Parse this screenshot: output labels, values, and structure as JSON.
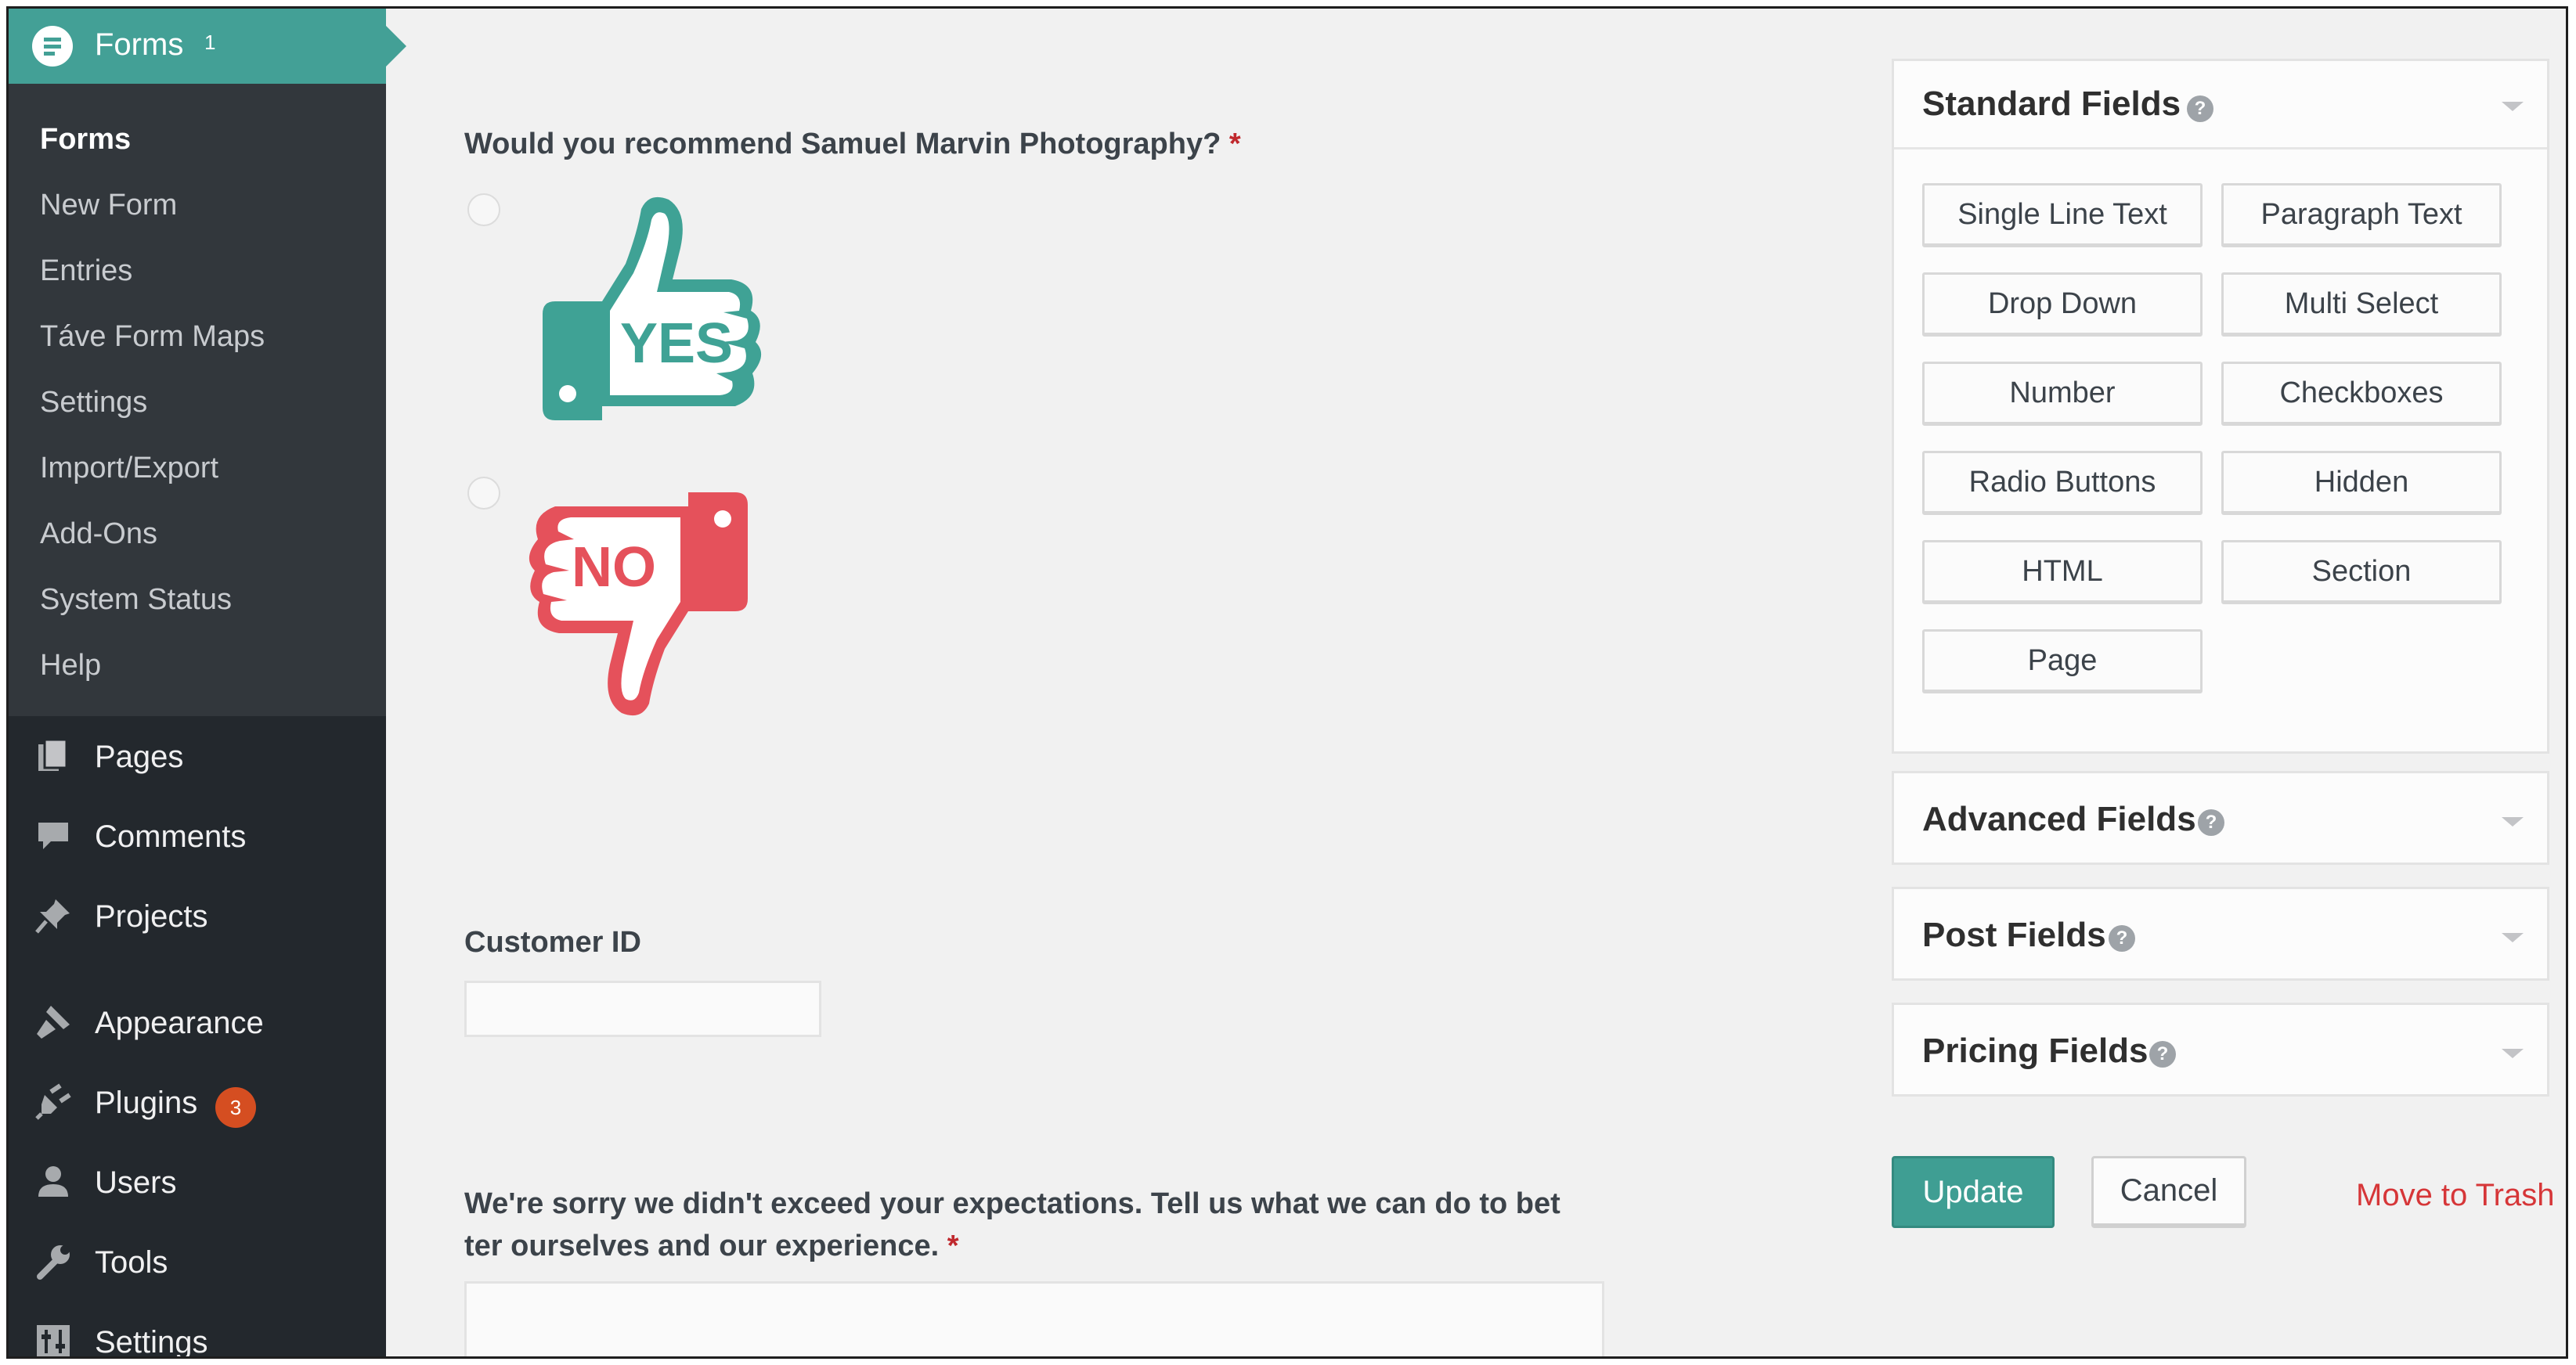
{
  "sidebar": {
    "forms_header": {
      "title": "Forms",
      "count": "1"
    },
    "submenu": [
      "Forms",
      "New Form",
      "Entries",
      "Táve Form Maps",
      "Settings",
      "Import/Export",
      "Add-Ons",
      "System Status",
      "Help"
    ],
    "menu": [
      {
        "label": "Pages",
        "icon": "pages-icon"
      },
      {
        "label": "Comments",
        "icon": "comments-icon"
      },
      {
        "label": "Projects",
        "icon": "pin-icon"
      },
      {
        "label": "Appearance",
        "icon": "brush-icon"
      },
      {
        "label": "Plugins",
        "icon": "plugin-icon",
        "badge": "3"
      },
      {
        "label": "Users",
        "icon": "user-icon"
      },
      {
        "label": "Tools",
        "icon": "wrench-icon"
      },
      {
        "label": "Settings",
        "icon": "settings-icon"
      }
    ]
  },
  "form": {
    "q1": {
      "label": "Would you recommend Samuel Marvin Photography?",
      "required": "*",
      "options": [
        {
          "text": "YES",
          "color": "#3fa295"
        },
        {
          "text": "NO",
          "color": "#e5515b"
        }
      ]
    },
    "customer_id": {
      "label": "Customer ID",
      "value": ""
    },
    "q3": {
      "line1": "We're sorry we didn't exceed your expectations. Tell us what we can do to bet",
      "line2": "ter ourselves and our experience.",
      "required": "*"
    }
  },
  "panels": {
    "standard": {
      "title": "Standard Fields",
      "buttons": [
        "Single Line Text",
        "Paragraph Text",
        "Drop Down",
        "Multi Select",
        "Number",
        "Checkboxes",
        "Radio Buttons",
        "Hidden",
        "HTML",
        "Section",
        "Page"
      ]
    },
    "advanced": {
      "title": "Advanced Fields"
    },
    "post": {
      "title": "Post Fields"
    },
    "pricing": {
      "title": "Pricing Fields"
    },
    "help_glyph": "?"
  },
  "actions": {
    "update": "Update",
    "cancel": "Cancel",
    "trash": "Move to Trash"
  },
  "colors": {
    "accent": "#43a096",
    "sidebar": "#23282d",
    "submenu": "#32373c",
    "danger": "#d63638",
    "yes": "#3fa295",
    "no": "#e5515b"
  }
}
